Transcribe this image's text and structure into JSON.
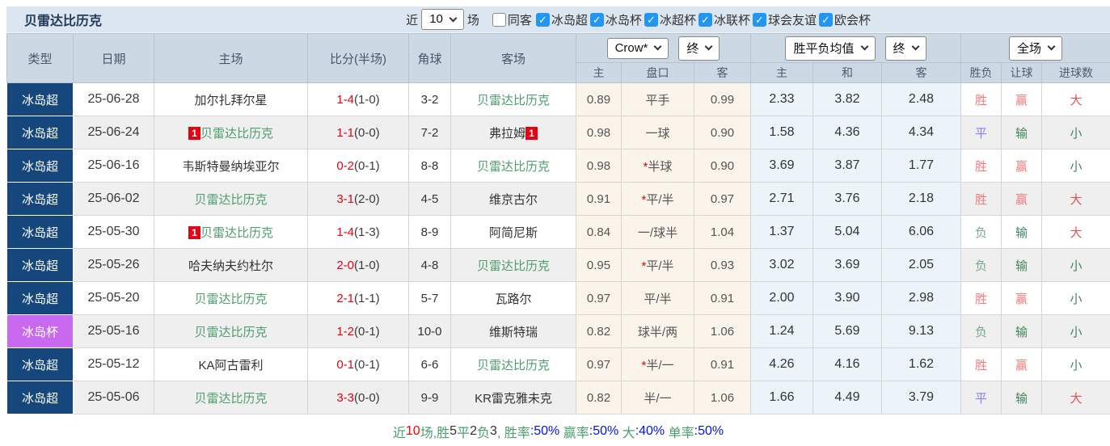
{
  "title": "贝雷达比历克",
  "controls": {
    "recent_label": "近",
    "recent_value": "10",
    "games_label": "场",
    "checkboxes": [
      {
        "label": "同客",
        "checked": false
      },
      {
        "label": "冰岛超",
        "checked": true
      },
      {
        "label": "冰岛杯",
        "checked": true
      },
      {
        "label": "冰超杯",
        "checked": true
      },
      {
        "label": "冰联杯",
        "checked": true
      },
      {
        "label": "球会友谊",
        "checked": true
      },
      {
        "label": "欧会杯",
        "checked": true
      }
    ]
  },
  "header": {
    "col_type": "类型",
    "col_date": "日期",
    "col_home": "主场",
    "col_score": "比分(半场)",
    "col_corner": "角球",
    "col_away": "客场",
    "odds_select": "Crow*",
    "odds_time_select": "终",
    "avg_select": "胜平负均值",
    "avg_time_select": "终",
    "scope_select": "全场",
    "sub_home": "主",
    "sub_handicap": "盘口",
    "sub_away": "客",
    "sub_avg_home": "主",
    "sub_avg_draw": "和",
    "sub_avg_away": "客",
    "col_wdl": "胜负",
    "col_letball": "让球",
    "col_goals": "进球数"
  },
  "table": {
    "rows": [
      {
        "type": "冰岛超",
        "type_cls": "",
        "date": "25-06-28",
        "home_badge": "",
        "home": "加尔扎拜尔星",
        "home_cls": "",
        "score": "1-4",
        "half": "(1-0)",
        "corner": "3-2",
        "away": "贝雷达比历克",
        "away_cls": "target",
        "away_badge": "",
        "crow_home": "0.89",
        "handicap_star": "",
        "handicap": "平手",
        "crow_away": "0.99",
        "avg_home": "2.33",
        "avg_draw": "3.82",
        "avg_away": "2.48",
        "wdl": "胜",
        "wdl_cls": "red",
        "letball": "赢",
        "letball_cls": "red",
        "goals": "大",
        "goals_cls": "red2"
      },
      {
        "type": "冰岛超",
        "type_cls": "",
        "date": "25-06-24",
        "home_badge": "1",
        "home": "贝雷达比历克",
        "home_cls": "target",
        "score": "1-1",
        "half": "(0-0)",
        "corner": "7-2",
        "away": "弗拉姆",
        "away_cls": "",
        "away_badge": "1",
        "crow_home": "0.98",
        "handicap_star": "",
        "handicap": "一球",
        "crow_away": "0.90",
        "avg_home": "1.58",
        "avg_draw": "4.36",
        "avg_away": "4.34",
        "wdl": "平",
        "wdl_cls": "blue",
        "letball": "输",
        "letball_cls": "green",
        "goals": "小",
        "goals_cls": "green"
      },
      {
        "type": "冰岛超",
        "type_cls": "",
        "date": "25-06-16",
        "home_badge": "",
        "home": "韦斯特曼纳埃亚尔",
        "home_cls": "",
        "score": "0-2",
        "half": "(0-1)",
        "corner": "8-8",
        "away": "贝雷达比历克",
        "away_cls": "target",
        "away_badge": "",
        "crow_home": "0.98",
        "handicap_star": "*",
        "handicap": "半球",
        "crow_away": "0.90",
        "avg_home": "3.69",
        "avg_draw": "3.87",
        "avg_away": "1.77",
        "wdl": "胜",
        "wdl_cls": "red",
        "letball": "赢",
        "letball_cls": "red",
        "goals": "小",
        "goals_cls": "green"
      },
      {
        "type": "冰岛超",
        "type_cls": "",
        "date": "25-06-02",
        "home_badge": "",
        "home": "贝雷达比历克",
        "home_cls": "target",
        "score": "3-1",
        "half": "(2-0)",
        "corner": "4-5",
        "away": "维京古尔",
        "away_cls": "",
        "away_badge": "",
        "crow_home": "0.91",
        "handicap_star": "*",
        "handicap": "平/半",
        "crow_away": "0.97",
        "avg_home": "2.71",
        "avg_draw": "3.76",
        "avg_away": "2.18",
        "wdl": "胜",
        "wdl_cls": "red",
        "letball": "赢",
        "letball_cls": "red",
        "goals": "大",
        "goals_cls": "red2"
      },
      {
        "type": "冰岛超",
        "type_cls": "",
        "date": "25-05-30",
        "home_badge": "1",
        "home": "贝雷达比历克",
        "home_cls": "target",
        "score": "1-4",
        "half": "(1-3)",
        "corner": "8-9",
        "away": "阿简尼斯",
        "away_cls": "",
        "away_badge": "",
        "crow_home": "0.84",
        "handicap_star": "",
        "handicap": "一/球半",
        "crow_away": "1.04",
        "avg_home": "1.37",
        "avg_draw": "5.04",
        "avg_away": "6.06",
        "wdl": "负",
        "wdl_cls": "green2",
        "letball": "输",
        "letball_cls": "green",
        "goals": "大",
        "goals_cls": "red2"
      },
      {
        "type": "冰岛超",
        "type_cls": "",
        "date": "25-05-26",
        "home_badge": "",
        "home": "哈夫纳夫约杜尔",
        "home_cls": "",
        "score": "2-0",
        "half": "(1-0)",
        "corner": "4-8",
        "away": "贝雷达比历克",
        "away_cls": "target",
        "away_badge": "",
        "crow_home": "0.95",
        "handicap_star": "*",
        "handicap": "平/半",
        "crow_away": "0.93",
        "avg_home": "3.02",
        "avg_draw": "3.69",
        "avg_away": "2.05",
        "wdl": "负",
        "wdl_cls": "green2",
        "letball": "输",
        "letball_cls": "green",
        "goals": "小",
        "goals_cls": "green"
      },
      {
        "type": "冰岛超",
        "type_cls": "",
        "date": "25-05-20",
        "home_badge": "",
        "home": "贝雷达比历克",
        "home_cls": "target",
        "score": "2-1",
        "half": "(1-1)",
        "corner": "5-7",
        "away": "瓦路尔",
        "away_cls": "",
        "away_badge": "",
        "crow_home": "0.97",
        "handicap_star": "",
        "handicap": "平/半",
        "crow_away": "0.91",
        "avg_home": "2.00",
        "avg_draw": "3.90",
        "avg_away": "2.98",
        "wdl": "胜",
        "wdl_cls": "red",
        "letball": "赢",
        "letball_cls": "red",
        "goals": "小",
        "goals_cls": "green"
      },
      {
        "type": "冰岛杯",
        "type_cls": "cup",
        "date": "25-05-16",
        "home_badge": "",
        "home": "贝雷达比历克",
        "home_cls": "target",
        "score": "1-2",
        "half": "(0-1)",
        "corner": "10-0",
        "away": "维斯特瑞",
        "away_cls": "",
        "away_badge": "",
        "crow_home": "0.82",
        "handicap_star": "",
        "handicap": "球半/两",
        "crow_away": "1.06",
        "avg_home": "1.24",
        "avg_draw": "5.69",
        "avg_away": "9.13",
        "wdl": "负",
        "wdl_cls": "green2",
        "letball": "输",
        "letball_cls": "green",
        "goals": "小",
        "goals_cls": "green"
      },
      {
        "type": "冰岛超",
        "type_cls": "",
        "date": "25-05-12",
        "home_badge": "",
        "home": "KA阿古雷利",
        "home_cls": "",
        "score": "0-1",
        "half": "(0-1)",
        "corner": "6-6",
        "away": "贝雷达比历克",
        "away_cls": "target",
        "away_badge": "",
        "crow_home": "0.97",
        "handicap_star": "*",
        "handicap": "半/一",
        "crow_away": "0.91",
        "avg_home": "4.26",
        "avg_draw": "4.16",
        "avg_away": "1.62",
        "wdl": "胜",
        "wdl_cls": "red",
        "letball": "赢",
        "letball_cls": "red",
        "goals": "小",
        "goals_cls": "green"
      },
      {
        "type": "冰岛超",
        "type_cls": "",
        "date": "25-05-06",
        "home_badge": "",
        "home": "贝雷达比历克",
        "home_cls": "target",
        "score": "3-3",
        "half": "(0-0)",
        "corner": "9-9",
        "away": "KR雷克雅未克",
        "away_cls": "",
        "away_badge": "",
        "crow_home": "0.82",
        "handicap_star": "",
        "handicap": "半/一",
        "crow_away": "1.06",
        "avg_home": "1.66",
        "avg_draw": "4.49",
        "avg_away": "3.79",
        "wdl": "平",
        "wdl_cls": "blue",
        "letball": "输",
        "letball_cls": "green",
        "goals": "大",
        "goals_cls": "red2"
      }
    ]
  },
  "footer": {
    "segments": [
      {
        "text": "近",
        "cls": "green"
      },
      {
        "text": "10",
        "cls": "red"
      },
      {
        "text": "场,胜",
        "cls": "green"
      },
      {
        "text": "5",
        "cls": "dark"
      },
      {
        "text": "平",
        "cls": "green"
      },
      {
        "text": "2",
        "cls": "dark"
      },
      {
        "text": "负",
        "cls": "green"
      },
      {
        "text": "3",
        "cls": "dark"
      },
      {
        "text": ", 胜率",
        "cls": "green"
      },
      {
        "text": ":50%",
        "cls": "blue"
      },
      {
        "text": " 赢率",
        "cls": "green"
      },
      {
        "text": ":50%",
        "cls": "blue"
      },
      {
        "text": " 大",
        "cls": "green"
      },
      {
        "text": ":40%",
        "cls": "blue"
      },
      {
        "text": " 单率",
        "cls": "green"
      },
      {
        "text": ":50%",
        "cls": "blue"
      }
    ]
  },
  "colors": {
    "league_navy": "#16477c",
    "cup_purple": "#c869f0",
    "target_team_green": "#4d9e6e",
    "score_red": "#e60012",
    "checkbox_blue": "#2196f3",
    "titlebar_bg": "#dce6f0",
    "header_bg": "#ccd8e4",
    "handicap_col_bg": "#faf4ea",
    "avg_col_bg": "#eaf4f9"
  }
}
